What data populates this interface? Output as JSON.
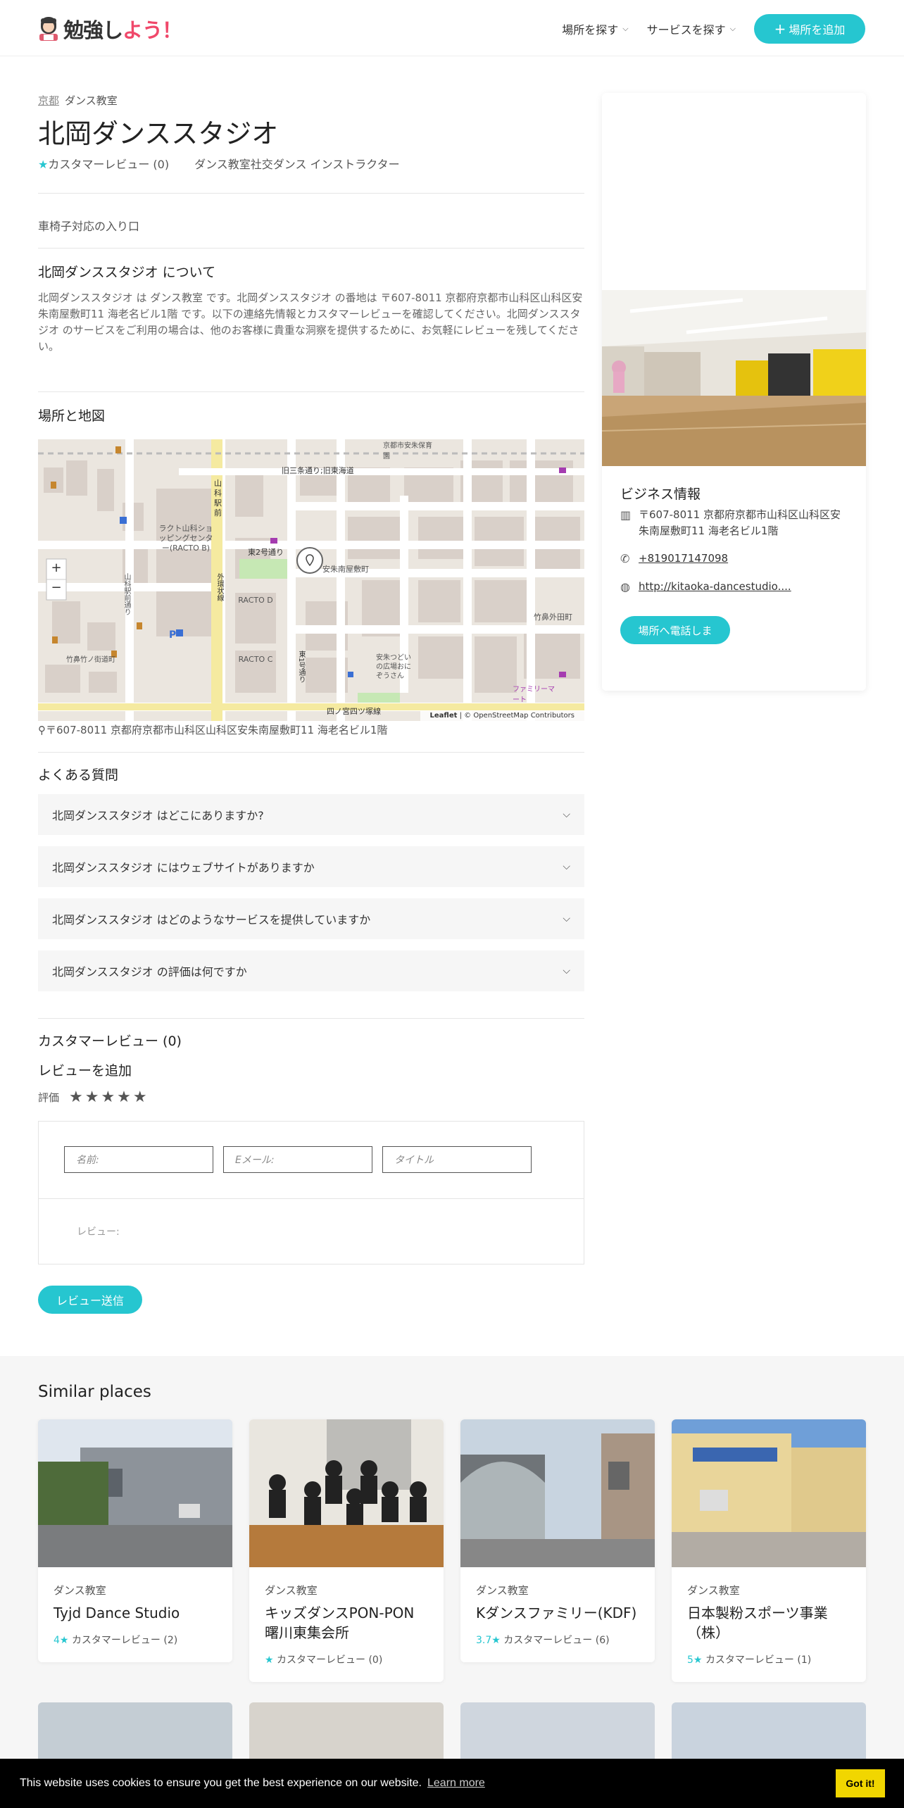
{
  "header": {
    "logo_main": "勉強し",
    "logo_accent": "よう！",
    "nav": [
      {
        "label": "場所を探す"
      },
      {
        "label": "サービスを探す"
      }
    ],
    "add_button": "場所を追加"
  },
  "breadcrumb": {
    "city": "京都",
    "category": "ダンス教室"
  },
  "place": {
    "title": "北岡ダンススタジオ",
    "review_label": "カスタマーレビュー (0)",
    "categories": "ダンス教室社交ダンス インストラクター",
    "amenity": "車椅子対応の入り口",
    "about_title": "北岡ダンススタジオ について",
    "about_text": "北岡ダンススタジオ は ダンス教室 です。北岡ダンススタジオ の番地は 〒607-8011 京都府京都市山科区山科区安朱南屋敷町11 海老名ビル1階 です。以下の連絡先情報とカスタマーレビューを確認してください。北岡ダンススタジオ のサービスをご利用の場合は、他のお客様に貴重な洞察を提供するために、お気軽にレビューを残してください。"
  },
  "map": {
    "title": "場所と地図",
    "attribution_leaflet": "Leaflet",
    "attribution_osm": "| © OpenStreetMap Contributors",
    "zoom_in": "+",
    "zoom_out": "−",
    "address": "〒607-8011 京都府京都市山科区山科区安朱南屋敷町11 海老名ビル1階",
    "labels": {
      "l1": "旧三条通り;旧東海道",
      "l2": "東2号通り",
      "l3": "安朱南屋敷町",
      "l4": "ラクト山科ショッピングセンター(RACTO B)",
      "l5": "RACTO D",
      "l6": "RACTO C",
      "l7": "四ノ宮四ツ塚線",
      "l8": "山科駅前",
      "l9": "竹鼻外田町",
      "l10": "ファミリーマート",
      "l11": "京都市安朱保育園",
      "l12": "安朱つどいの広場おにぞうさん",
      "l13": "竹鼻竹ノ街道町",
      "l14": "山科駅前通り",
      "l15": "外環状線",
      "l16": "東1号通り"
    }
  },
  "faq": {
    "title": "よくある質問",
    "items": [
      {
        "q": "北岡ダンススタジオ はどこにありますか?"
      },
      {
        "q": "北岡ダンススタジオ にはウェブサイトがありますか"
      },
      {
        "q": "北岡ダンススタジオ はどのようなサービスを提供していますか"
      },
      {
        "q": "北岡ダンススタジオ の評価は何ですか"
      }
    ]
  },
  "reviews": {
    "count_label": "カスタマーレビュー (0)",
    "add_title": "レビューを追加",
    "rating_label": "評価",
    "stars": "★★★★★",
    "name_placeholder": "名前:",
    "email_placeholder": "Eメール:",
    "subject_placeholder": "タイトル",
    "review_placeholder": "レビュー:",
    "submit": "レビュー送信"
  },
  "business": {
    "title": "ビジネス情報",
    "address": "〒607-8011 京都府京都市山科区山科区安朱南屋敷町11 海老名ビル1階",
    "phone": "+819017147098",
    "website": "http://kitaoka-dancestudio....",
    "call_button": "場所へ電話しま"
  },
  "similar": {
    "title": "Similar places",
    "items": [
      {
        "category": "ダンス教室",
        "name": "Tyjd Dance Studio",
        "rating": "4",
        "reviews": "カスタマーレビュー (2)"
      },
      {
        "category": "ダンス教室",
        "name": "キッズダンスPON-PON曙川東集会所",
        "rating": "",
        "reviews": "カスタマーレビュー (0)"
      },
      {
        "category": "ダンス教室",
        "name": "Kダンスファミリー(KDF)",
        "rating": "3.7",
        "reviews": "カスタマーレビュー (6)"
      },
      {
        "category": "ダンス教室",
        "name": "日本製粉スポーツ事業（株）",
        "rating": "5",
        "reviews": "カスタマーレビュー (1)"
      }
    ]
  },
  "cookie": {
    "message": "This website uses cookies to ensure you get the best experience on our website.",
    "link": "Learn more",
    "button": "Got it!"
  },
  "colors": {
    "accent": "#26c6d0",
    "logo_accent": "#f0486a",
    "cookie_button": "#f1d600"
  }
}
